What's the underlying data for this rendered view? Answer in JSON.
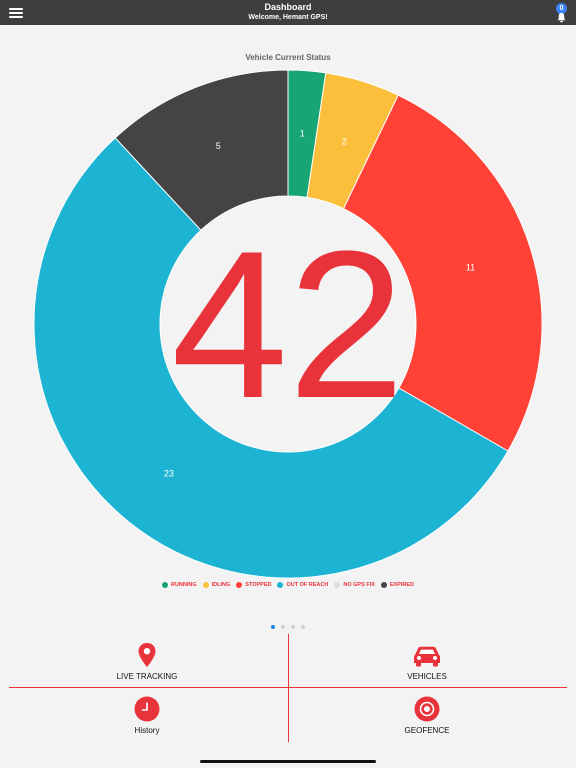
{
  "header": {
    "title": "Dashboard",
    "subtitle": "Welcome, Hemant GPS!",
    "notification_count": "0"
  },
  "chart_data": {
    "type": "pie",
    "title": "Vehicle Current Status",
    "center_total": "42",
    "categories": [
      "RUNNING",
      "IDLING",
      "STOPPED",
      "OUT OF REACH",
      "NO GPS FIX",
      "EXPIRED"
    ],
    "values": [
      1,
      2,
      11,
      23,
      0,
      5
    ],
    "colors": [
      "#17a673",
      "#fbbf3c",
      "#ff4136",
      "#1db4d4",
      "#dcdcdc",
      "#454343"
    ],
    "legend_position": "bottom"
  },
  "pager": {
    "pages": 4,
    "active": 0
  },
  "tiles": {
    "live_tracking": "LIVE TRACKING",
    "vehicles": "VEHICLES",
    "history": "History",
    "geofence": "GEOFENCE"
  },
  "colors": {
    "accent": "#e8333a",
    "header_bg": "#3e3e3e",
    "badge": "#3b82f6"
  }
}
